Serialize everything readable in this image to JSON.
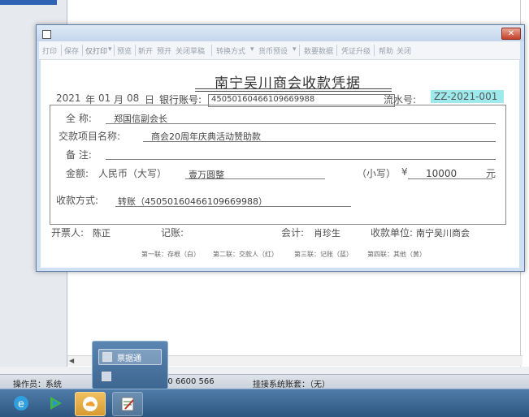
{
  "toolbar": {
    "print": "打印",
    "save": "保存",
    "print_only": "仅打印",
    "preview": "预览",
    "add_new": "新开",
    "reopen": "预开",
    "save_draft": "关闭草稿",
    "convert_mode": "转换方式",
    "currency_options": "货币预设",
    "data_fetch": "数要数据",
    "voucher_upgrade": "凭证升级",
    "help": "帮助",
    "close": "关闭"
  },
  "voucher": {
    "title": "南宁吴川商会收款凭据",
    "year": "2021",
    "year_unit": "年",
    "month": "01",
    "month_unit": "月",
    "day": "08",
    "day_unit": "日",
    "bank_account_label": "银行账号:",
    "bank_account_value": "450501604661096699 88",
    "serial_label": "流水号:",
    "serial_value": "ZZ-2021-001",
    "payer_label": "全 称:",
    "payer_value": "郑国信副会长",
    "item_label": "交款项目名称:",
    "item_value": "商会20周年庆典活动赞助款",
    "remark_label": "备 注:",
    "remark_value": "",
    "amount_label": "金额:",
    "currency_label": "人民币（大写）",
    "amount_words": "壹万圆整",
    "lowercase_label": "（小写）",
    "yen_symbol": "¥",
    "amount_number": "10000",
    "yuan_unit": "元",
    "payment_method_label": "收款方式:",
    "payment_method_value": "转账（450501604661096699 88）",
    "issuer_label": "开票人:",
    "issuer_value": "陈正",
    "bookkeeper_label": "记账:",
    "bookkeeper_value": "",
    "accountant_label": "会计:",
    "accountant_value": "肖珍生",
    "receiver_label": "收款单位:",
    "receiver_value": "南宁吴川商会",
    "copy1": "第一联：存根（白）",
    "copy2": "第二联：交款人（红）",
    "copy3": "第三联：记账（蓝）",
    "copy4": "第四联：其他（黄）"
  },
  "status_bar": {
    "operator": "操作员：系统",
    "phone": "00 6600 566",
    "system_account": "挂接系统账套：（无）"
  },
  "popup": {
    "item1": "票据通",
    "item2": ""
  },
  "colors": {
    "serial_highlight": "#9ee9ec",
    "taskbar": "#2c5680",
    "dialog_frame": "#cfe0f3"
  }
}
